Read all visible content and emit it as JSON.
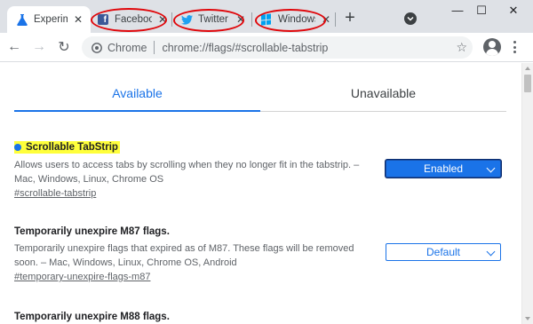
{
  "browser": {
    "tabs": [
      {
        "title": "Experiments",
        "favicon": "flask-icon",
        "active": true
      },
      {
        "title": "Facebook",
        "favicon": "facebook-icon",
        "active": false
      },
      {
        "title": "Twitter",
        "favicon": "twitter-icon",
        "active": false
      },
      {
        "title": "Windows",
        "favicon": "windows-icon",
        "active": false
      }
    ],
    "new_tab_label": "+",
    "window_controls": {
      "minimize": "—",
      "maximize": "☐",
      "close": "✕"
    },
    "back_label": "←",
    "forward_label": "→",
    "reload_label": "↻",
    "omnibox": {
      "chip": "Chrome",
      "url": "chrome://flags/#scrollable-tabstrip"
    },
    "bookmark_label": "☆",
    "highlight_color": "#e0070b"
  },
  "flags_page": {
    "tabs": {
      "available": "Available",
      "unavailable": "Unavailable"
    },
    "experiments": [
      {
        "title": "Scrollable TabStrip",
        "description": "Allows users to access tabs by scrolling when they no longer fit in the tabstrip. – Mac, Windows, Linux, Chrome OS",
        "link": "#scrollable-tabstrip",
        "value": "Enabled",
        "highlighted": true
      },
      {
        "title": "Temporarily unexpire M87 flags.",
        "description": "Temporarily unexpire flags that expired as of M87. These flags will be removed soon. – Mac, Windows, Linux, Chrome OS, Android",
        "link": "#temporary-unexpire-flags-m87",
        "value": "Default",
        "highlighted": false
      },
      {
        "title": "Temporarily unexpire M88 flags.",
        "highlighted": false
      }
    ]
  },
  "colors": {
    "accent": "#1a73e8",
    "highlight": "#ffff3b",
    "tabstrip_bg": "#dee1e6"
  }
}
